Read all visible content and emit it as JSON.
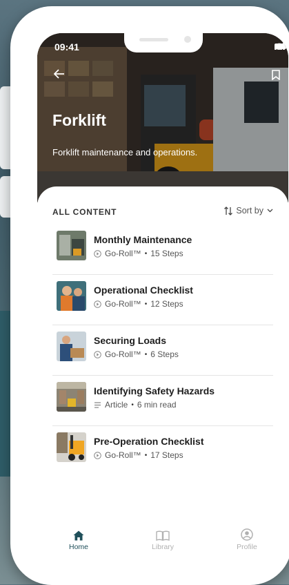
{
  "status_bar": {
    "time": "09:41"
  },
  "header": {
    "title": "Forklift",
    "subtitle": "Forklift maintenance and operations."
  },
  "content": {
    "section_label": "ALL CONTENT",
    "sort_label": "Sort by"
  },
  "items": [
    {
      "title": "Monthly Maintenance",
      "type_icon": "play-circle-icon",
      "type": "Go-Roll™",
      "separator": "•",
      "detail": "15 Steps"
    },
    {
      "title": "Operational Checklist",
      "type_icon": "play-circle-icon",
      "type": "Go-Roll™",
      "separator": "•",
      "detail": "12 Steps"
    },
    {
      "title": "Securing Loads",
      "type_icon": "play-circle-icon",
      "type": "Go-Roll™",
      "separator": "•",
      "detail": "6 Steps"
    },
    {
      "title": "Identifying Safety Hazards",
      "type_icon": "article-icon",
      "type": "Article",
      "separator": "•",
      "detail": "6 min read"
    },
    {
      "title": "Pre-Operation Checklist",
      "type_icon": "play-circle-icon",
      "type": "Go-Roll™",
      "separator": "•",
      "detail": "17 Steps"
    }
  ],
  "tabs": [
    {
      "label": "Home",
      "icon": "home-icon",
      "active": true
    },
    {
      "label": "Library",
      "icon": "book-icon",
      "active": false
    },
    {
      "label": "Profile",
      "icon": "profile-icon",
      "active": false
    }
  ],
  "colors": {
    "accent": "#1f4f5a",
    "inactive_tab": "#b0b0b0",
    "background_teal": "#2f5d68"
  }
}
